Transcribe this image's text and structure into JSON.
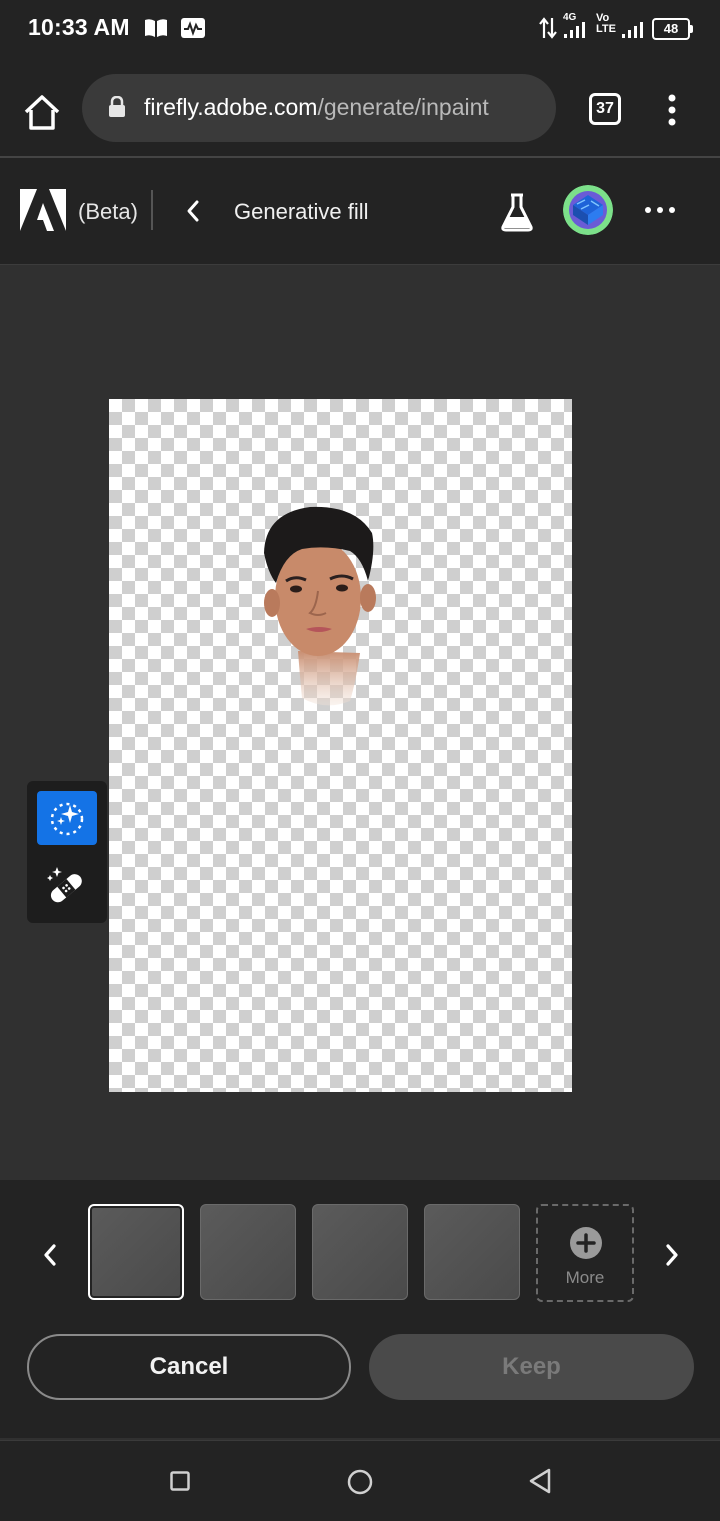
{
  "status_bar": {
    "time": "10:33 AM",
    "network": "4G",
    "volte": "Vo LTE",
    "battery": "48",
    "icons": [
      "book-icon",
      "activity-icon",
      "data-arrows-icon",
      "signal-icon",
      "signal-icon",
      "battery-icon"
    ]
  },
  "browser": {
    "url_host": "firefly.adobe.com",
    "url_path": "/generate/inpaint",
    "tab_count": "37",
    "icons": [
      "home-icon",
      "lock-icon",
      "tabs-icon",
      "kebab-menu-icon"
    ]
  },
  "app_header": {
    "beta_label": "(Beta)",
    "page_title": "Generative fill",
    "icons": [
      "adobe-logo-icon",
      "chevron-left-icon",
      "labs-flask-icon",
      "avatar",
      "more-horizontal-icon"
    ]
  },
  "tools": {
    "items": [
      {
        "name": "insert",
        "icon": "sparkle-brush-icon",
        "active": true
      },
      {
        "name": "remove",
        "icon": "bandage-sparkle-icon",
        "active": false
      }
    ],
    "accent_color": "#1473e6"
  },
  "variations": {
    "thumbnails": 4,
    "selected_index": 0,
    "more_label": "More"
  },
  "actions": {
    "cancel_label": "Cancel",
    "keep_label": "Keep"
  },
  "nav_bar": {
    "icons": [
      "recents-square-icon",
      "home-circle-icon",
      "back-triangle-icon"
    ]
  }
}
